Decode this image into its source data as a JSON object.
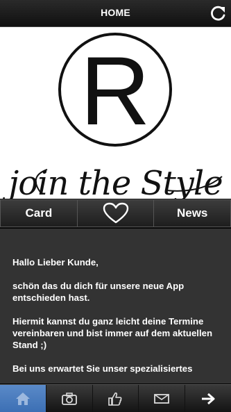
{
  "header": {
    "title": "HOME",
    "refresh_icon": "refresh-icon"
  },
  "logo": {
    "letter": "R",
    "tagline": "join the Style"
  },
  "segments": [
    {
      "label": "Card"
    },
    {
      "label": "",
      "icon": "heart-icon"
    },
    {
      "label": "News"
    }
  ],
  "content": {
    "paragraphs": [
      "Hallo Lieber Kunde,",
      "schön das du dich für unsere neue App entschieden hast.",
      "Hiermit kannst du ganz leicht deine Termine vereinbaren und bist immer auf dem aktuellen Stand ;)",
      "Bei uns erwartet Sie unser spezialisiertes"
    ]
  },
  "bottom_nav": [
    {
      "icon": "home-icon",
      "active": true
    },
    {
      "icon": "camera-icon",
      "active": false
    },
    {
      "icon": "thumbs-up-icon",
      "active": false
    },
    {
      "icon": "mail-icon",
      "active": false
    },
    {
      "icon": "arrow-right-icon",
      "active": false
    }
  ],
  "colors": {
    "active_tab": "#4a7fc0",
    "content_bg": "#333333",
    "logo_bg": "#ffffff"
  }
}
